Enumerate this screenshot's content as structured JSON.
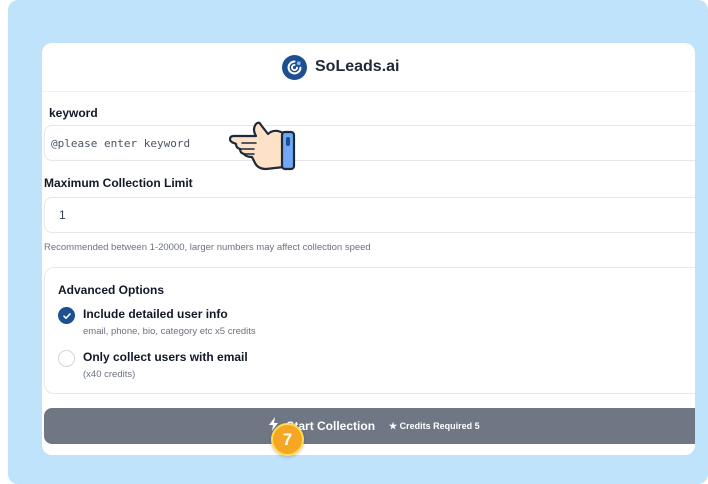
{
  "app": {
    "name": "SoLeads.ai"
  },
  "form": {
    "keyword_label": "keyword",
    "keyword_placeholder": "@please enter keyword",
    "limit_label": "Maximum Collection Limit",
    "limit_value": "1",
    "limit_hint": "Recommended between 1-20000, larger numbers may affect collection speed"
  },
  "advanced": {
    "title": "Advanced Options",
    "options": [
      {
        "label": "Include detailed user info",
        "sub": "email, phone, bio, category etc x5 credits",
        "checked": true
      },
      {
        "label": "Only collect users with email",
        "sub": "(x40 credits)",
        "checked": false
      }
    ]
  },
  "action": {
    "start_label": "Start Collection",
    "credits_label": "Credits Required 5",
    "icon": "lightning-icon"
  },
  "overlay": {
    "step_number": "7",
    "pointer": "pointing-hand-icon"
  },
  "colors": {
    "frame": "#bfe3fb",
    "brand": "#1d4f91",
    "button": "#6f7784",
    "step_badge": "#f5a623"
  }
}
